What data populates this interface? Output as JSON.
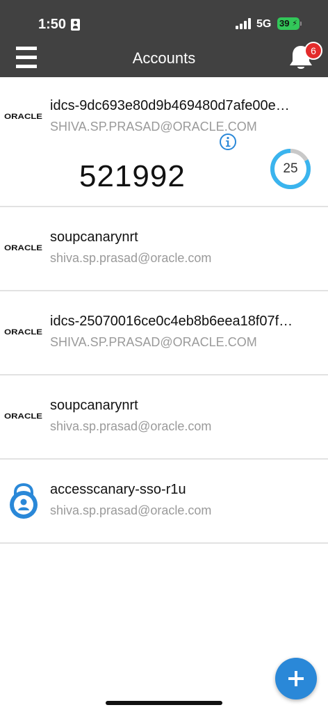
{
  "status_bar": {
    "time": "1:50",
    "network": "5G",
    "battery": "39"
  },
  "header": {
    "title": "Accounts",
    "notification_count": "6"
  },
  "accounts": [
    {
      "logo": "ORACLE",
      "name": "idcs-9dc693e80d9b469480d7afe00e…",
      "email": "SHIVA.SP.PRASAD@ORACLE.COM",
      "otp": "521992",
      "timer_seconds": "25",
      "timer_fraction_remaining": 0.83
    },
    {
      "logo": "ORACLE",
      "name": "soupcanarynrt",
      "email": "shiva.sp.prasad@oracle.com"
    },
    {
      "logo": "ORACLE",
      "name": "idcs-25070016ce0c4eb8b6eea18f07f…",
      "email": "SHIVA.SP.PRASAD@ORACLE.COM"
    },
    {
      "logo": "ORACLE",
      "name": "soupcanarynrt",
      "email": "shiva.sp.prasad@oracle.com"
    },
    {
      "logo_icon": "lock-person-icon",
      "name": "accesscanary-sso-r1u",
      "email": "shiva.sp.prasad@oracle.com"
    }
  ],
  "colors": {
    "header_bg": "#414141",
    "accent_blue": "#2a88d8",
    "timer_blue": "#3ab4ee",
    "badge_red": "#e32b2b",
    "battery_green": "#32c759"
  }
}
